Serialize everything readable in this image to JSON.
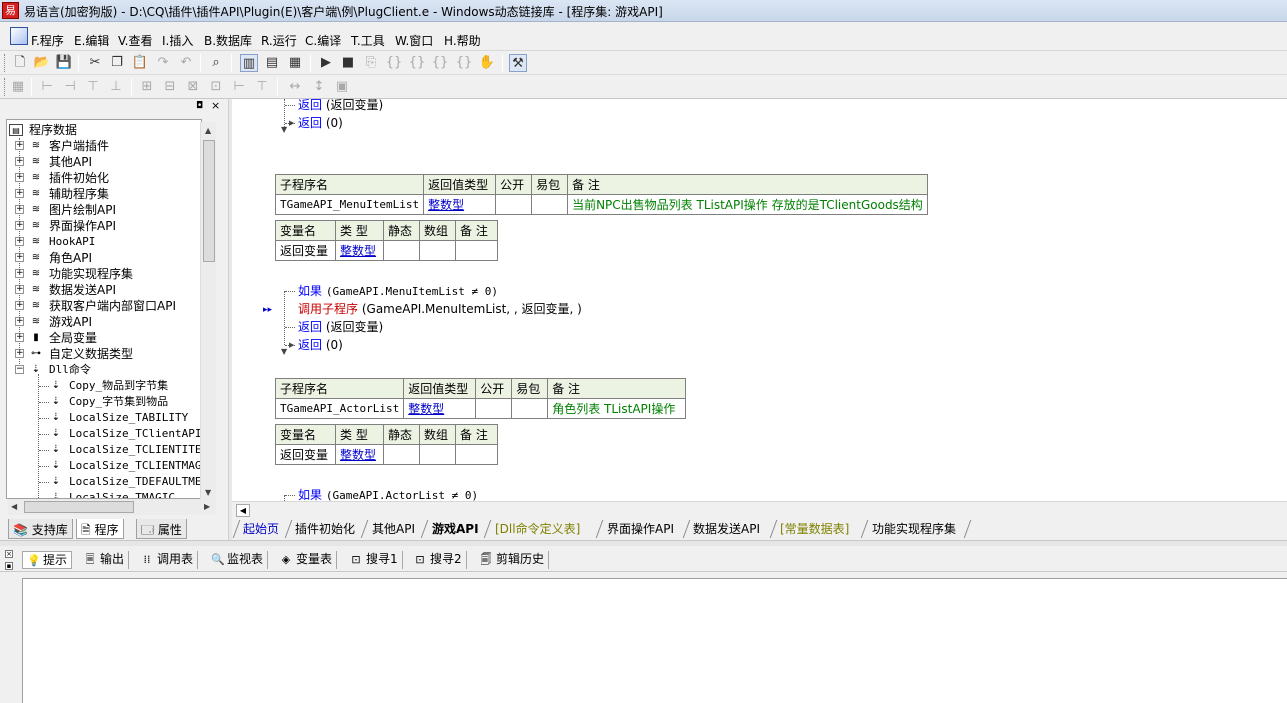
{
  "window": {
    "title": "易语言(加密狗版) - D:\\CQ\\插件\\插件API\\Plugin(E)\\客户端\\例\\PlugClient.e - Windows动态链接库 - [程序集: 游戏API]"
  },
  "menu": [
    "F.程序",
    "E.编辑",
    "V.查看",
    "I.插入",
    "B.数据库",
    "R.运行",
    "C.编译",
    "T.工具",
    "W.窗口",
    "H.帮助"
  ],
  "tree": {
    "root": "程序数据",
    "items": [
      "客户端插件",
      "其他API",
      "插件初始化",
      "辅助程序集",
      "图片绘制API",
      "界面操作API",
      "HookAPI",
      "角色API",
      "功能实现程序集",
      "数据发送API",
      "获取客户端内部窗口API",
      "游戏API",
      "全局变量",
      "自定义数据类型",
      "Dll命令"
    ],
    "dll_children": [
      "Copy_物品到字节集",
      "Copy_字节集到物品",
      "LocalSize_TABILITY",
      "LocalSize_TClientAPI",
      "LocalSize_TCLIENTITEM",
      "LocalSize_TCLIENTMAGIC",
      "LocalSize_TDEFAULTMESS",
      "LocalSize_TMAGIC"
    ]
  },
  "left_tabs": [
    "支持库",
    "程序",
    "属性"
  ],
  "code": {
    "top_lines": [
      {
        "kw": "返回",
        "arg": "(返回变量)"
      },
      {
        "kw": "返回",
        "arg": "(0)"
      }
    ],
    "sub_header": [
      "子程序名",
      "返回值类型",
      "公开",
      "易包",
      "备 注"
    ],
    "var_header": [
      "变量名",
      "类 型",
      "静态",
      "数组",
      "备 注"
    ],
    "sub1": {
      "name": "TGameAPI_MenuItemList",
      "type": "整数型",
      "note": "当前NPC出售物品列表 TListAPI操作 存放的是TClientGoods结构",
      "var_name": "返回变量",
      "var_type": "整数型"
    },
    "block1": [
      {
        "kw": "如果",
        "arg": "(GameAPI.MenuItemList ≠ 0)"
      },
      {
        "call": "调用子程序",
        "arg": "(GameAPI.MenuItemList, , 返回变量, )"
      },
      {
        "kw": "返回",
        "arg": "(返回变量)"
      },
      {
        "kw": "返回",
        "arg": "(0)"
      }
    ],
    "sub2": {
      "name": "TGameAPI_ActorList",
      "type": "整数型",
      "note": "角色列表 TListAPI操作",
      "var_name": "返回变量",
      "var_type": "整数型"
    },
    "block2": [
      {
        "kw": "如果",
        "arg": "(GameAPI.ActorList ≠ 0)"
      }
    ]
  },
  "doc_tabs": [
    "起始页",
    "插件初始化",
    "其他API",
    "游戏API",
    "[Dll命令定义表]",
    "界面操作API",
    "数据发送API",
    "[常量数据表]",
    "功能实现程序集"
  ],
  "output_tabs": [
    "提示",
    "输出",
    "调用表",
    "监视表",
    "变量表",
    "搜寻1",
    "搜寻2",
    "剪辑历史"
  ]
}
